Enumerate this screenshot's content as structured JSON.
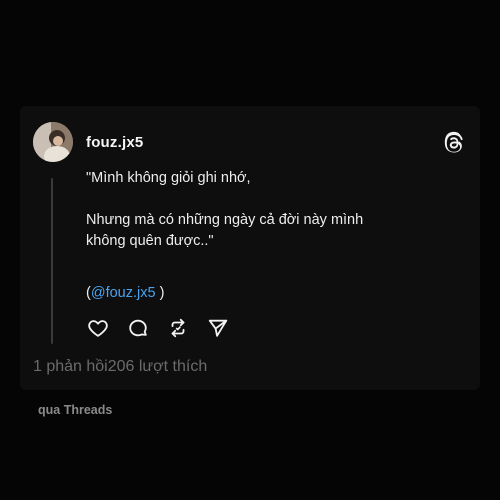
{
  "post": {
    "username": "fouz.jx5",
    "lines": [
      "\"Mình không giỏi ghi nhớ,",
      "",
      "Nhưng mà có những ngày cả đời này mình",
      "không quên được..\""
    ],
    "mention_open": "(",
    "mention": "@fouz.jx5",
    "mention_close": " )"
  },
  "icons": {
    "like": "heart-icon",
    "reply": "comment-icon",
    "repost": "repost-icon",
    "share": "send-icon",
    "brand": "threads-logo-icon"
  },
  "stats": {
    "replies": "1 phản hồi",
    "likes": "206 lượt thích"
  },
  "footer": {
    "via": "qua Threads"
  },
  "colors": {
    "background": "#050505",
    "card": "#0e0e0e",
    "mention": "#4aa3ef",
    "muted": "#6b6b6b"
  }
}
